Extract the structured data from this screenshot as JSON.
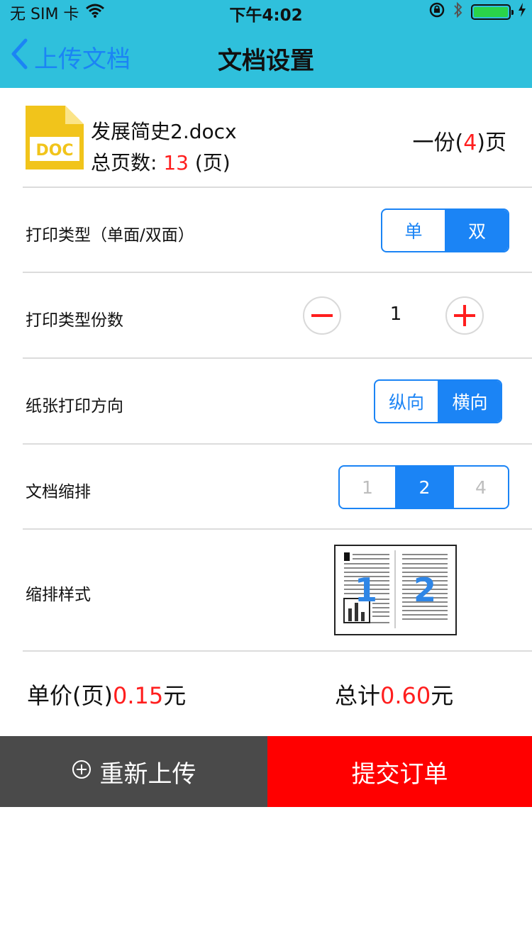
{
  "status_bar": {
    "carrier": "无 SIM 卡",
    "time": "下午4:02",
    "wifi_icon": "wifi-icon",
    "lock_icon": "rotation-lock-icon",
    "bluetooth_icon": "bluetooth-icon",
    "battery_icon": "battery-icon",
    "charging_icon": "charging-icon"
  },
  "nav": {
    "back_label": "上传文档",
    "title": "文档设置"
  },
  "file": {
    "icon": "doc-file-icon",
    "icon_text": "DOC",
    "name": "发展简史2.docx",
    "total_label": "总页数: ",
    "total_pages": "13",
    "total_suffix": " (页)",
    "per_copy_prefix": "一份(",
    "per_copy_pages": "4",
    "per_copy_suffix": ")页"
  },
  "settings": {
    "print_side": {
      "label": "打印类型（单面/双面）",
      "options": [
        "单",
        "双"
      ],
      "selected": "双"
    },
    "copies": {
      "label": "打印类型份数",
      "value": "1",
      "minus_icon": "minus-icon",
      "plus_icon": "plus-icon"
    },
    "orientation": {
      "label": "纸张打印方向",
      "options": [
        "纵向",
        "横向"
      ],
      "selected": "横向"
    },
    "nup": {
      "label": "文档缩排",
      "options": [
        "1",
        "2",
        "4"
      ],
      "selected": "2"
    },
    "nup_style": {
      "label": "缩排样式",
      "preview_numbers": [
        "1",
        "2"
      ],
      "preview_icon": "two-up-layout-preview"
    }
  },
  "pricing": {
    "unit_label": "单价(页)",
    "unit_value": "0.15",
    "unit_suffix": "元",
    "total_label": "总计",
    "total_value": "0.60",
    "total_suffix": "元"
  },
  "actions": {
    "reupload_icon": "circle-plus-icon",
    "reupload_label": "重新上传",
    "submit_label": "提交订单"
  },
  "colors": {
    "header_bg": "#2fc0dc",
    "accent_blue": "#1b84f5",
    "price_red": "#ff1e1e",
    "submit_red": "#ff0000",
    "reupload_gray": "#4a4a4a"
  }
}
